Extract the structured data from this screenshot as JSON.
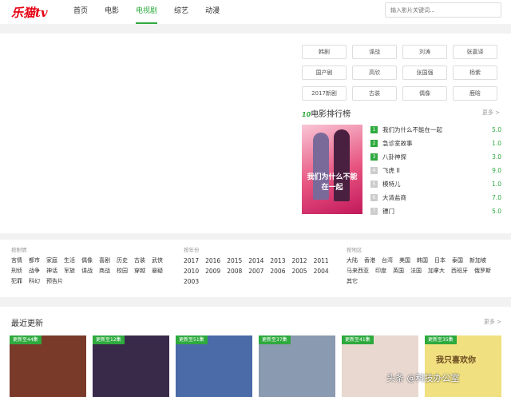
{
  "header": {
    "logo": "乐猫tv",
    "nav": [
      "首页",
      "电影",
      "电视剧",
      "综艺",
      "动漫"
    ],
    "active_nav": "电视剧",
    "search_placeholder": "输入影片关键词..."
  },
  "tags": [
    "韩剧",
    "谍战",
    "刘涛",
    "张嘉译",
    "国产剧",
    "高欣",
    "张国强",
    "杨紫",
    "2017新剧",
    "古装",
    "偶像",
    "鹿晗"
  ],
  "ranking": {
    "title_prefix": "10",
    "title": "电影排行榜",
    "more": "更多 >",
    "poster_text": "我们为什么不能在一起",
    "items": [
      {
        "rank": "1",
        "name": "我们为什么不能在一起",
        "score": "5.0"
      },
      {
        "rank": "2",
        "name": "急诊室故事",
        "score": "1.0"
      },
      {
        "rank": "3",
        "name": "八卦神探",
        "score": "3.0"
      },
      {
        "rank": "4",
        "name": "飞虎 II",
        "score": "9.0"
      },
      {
        "rank": "5",
        "name": "模特儿",
        "score": "1.0"
      },
      {
        "rank": "6",
        "name": "大清盐商",
        "score": "7.0"
      },
      {
        "rank": "7",
        "name": "镖门",
        "score": "5.0"
      }
    ]
  },
  "filters": {
    "genre": {
      "label": "按剧情",
      "items": [
        "言情",
        "都市",
        "家庭",
        "生活",
        "偶像",
        "喜剧",
        "历史",
        "古装",
        "武侠",
        "刑侦",
        "战争",
        "神话",
        "军旅",
        "谍战",
        "商战",
        "校园",
        "穿越",
        "悬疑",
        "犯罪",
        "科幻",
        "预告片"
      ]
    },
    "year": {
      "label": "按年份",
      "items": [
        "2017",
        "2016",
        "2015",
        "2014",
        "2013",
        "2012",
        "2011",
        "2010",
        "2009",
        "2008",
        "2007",
        "2006",
        "2005",
        "2004",
        "2003"
      ]
    },
    "region": {
      "label": "按地区",
      "items": [
        "大陆",
        "香港",
        "台湾",
        "美国",
        "韩国",
        "日本",
        "泰国",
        "新加坡",
        "马来西亚",
        "印度",
        "英国",
        "法国",
        "加拿大",
        "西班牙",
        "俄罗斯",
        "其它"
      ]
    }
  },
  "recent": {
    "title": "最近更新",
    "more": "更多 >",
    "thumbs": [
      {
        "badge": "更新至44集",
        "color": "#7a3a2a"
      },
      {
        "badge": "更新至12集",
        "color": "#3a2a4a"
      },
      {
        "badge": "更新至51集",
        "color": "#4a6aa8"
      },
      {
        "badge": "更新至37集",
        "color": "#8a9ab0"
      },
      {
        "badge": "更新至41集",
        "color": "#e8d8d0"
      },
      {
        "badge": "更新至35集",
        "color": "#f0e080"
      }
    ],
    "thumb_texts": [
      "",
      "",
      "",
      "",
      "",
      "我只喜欢你"
    ]
  },
  "watermark": "头条 @科技办公室",
  "colors": {
    "accent": "#2eaa3e",
    "logo": "#e60012"
  }
}
